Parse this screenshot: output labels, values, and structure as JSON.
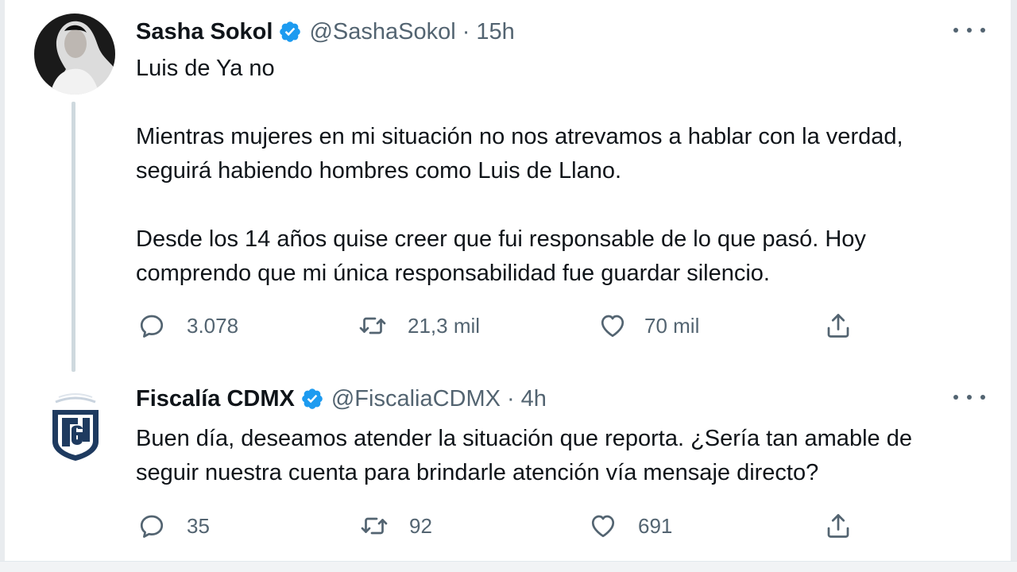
{
  "tweets": [
    {
      "author": {
        "name": "Sasha Sokol",
        "handle": "@SashaSokol",
        "verified": true
      },
      "separator": "·",
      "time": "15h",
      "text": {
        "p1": "Luis de Ya no",
        "p2_l1": "Mientras mujeres en mi situación no nos atrevamos a hablar con la verdad,",
        "p2_l2": "seguirá habiendo hombres como Luis de Llano.",
        "p3_l1": "Desde los 14 años quise creer que fui responsable de lo que pasó. Hoy",
        "p3_l2": "comprendo que mi única responsabilidad fue guardar silencio."
      },
      "stats": {
        "replies": "3.078",
        "retweets": "21,3 mil",
        "likes": "70 mil"
      }
    },
    {
      "author": {
        "name": "Fiscalía CDMX",
        "handle": "@FiscaliaCDMX",
        "verified": true
      },
      "separator": "·",
      "time": "4h",
      "text": {
        "l1": "Buen día, deseamos atender la situación que reporta. ¿Sería tan amable de",
        "l2": "seguir nuestra cuenta para brindarle atención vía mensaje directo?"
      },
      "stats": {
        "replies": "35",
        "retweets": "92",
        "likes": "691"
      }
    }
  ],
  "icons": {
    "verified": "verified-badge-icon",
    "more": "more-options-icon",
    "reply": "reply-icon",
    "retweet": "retweet-icon",
    "like": "like-icon",
    "share": "share-icon"
  },
  "colors": {
    "verified": "#1d9bf0",
    "text_primary": "#0f1419",
    "text_secondary": "#536471",
    "thread_line": "#cfd9de",
    "fiscalia_logo": "#1e3a5f"
  }
}
